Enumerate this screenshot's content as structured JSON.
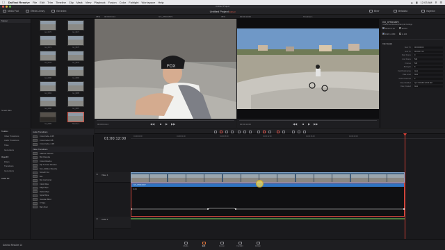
{
  "menubar": {
    "app": "DaVinci Resolve",
    "items": [
      "File",
      "Edit",
      "Trim",
      "Timeline",
      "Clip",
      "Mark",
      "View",
      "Playback",
      "Fusion",
      "Color",
      "Fairlight",
      "Workspace",
      "Help"
    ],
    "clock": "12:03 AM"
  },
  "window_title": "Untitled Project",
  "toolbar": {
    "media_pool": "Media Pool",
    "effects_library": "Effects Library",
    "edit_index": "Edit Index",
    "project": "Untitled Project",
    "project_state": "Edited",
    "mixer": "Mixer",
    "metadata": "Metadata",
    "inspector": "Inspector"
  },
  "subbar": {
    "zoom_left": "35%",
    "tc_left": "00:00:04:14",
    "clip_name": "GX_0793.MOV",
    "zoom_right": "35%",
    "tc_right": "00:00:12:00",
    "timeline_name": "Timeline 1"
  },
  "media_pool": {
    "bin": "Master",
    "smart_bins": "Smart Bins",
    "clips": [
      "GL_0070",
      "GL_0071",
      "GL_0074",
      "GL_0076",
      "GL_0078",
      "GL_0079",
      "GL_0080",
      "GL_0083",
      "GL_0084",
      "GL_0085",
      "GL_0086",
      "GL_0087",
      "GL_0089",
      "Timeline 1"
    ]
  },
  "viewer_left": {
    "tc": "00:00:04:14"
  },
  "viewer_right": {
    "tc": "00:00:12:00"
  },
  "inspector": {
    "clip_title": "GX_0793.MOV",
    "path": "/Users/mac/Desktop/Sample Footage",
    "checkboxes": [
      "00:00:17:19",
      "29.970",
      "1920 x 1080",
      "H.264"
    ],
    "section": "Clip Details",
    "fields": [
      {
        "k": "Start TC",
        "v": "00:00:00:00"
      },
      {
        "k": "End TC",
        "v": "00:00:17:19"
      },
      {
        "k": "Start Frame",
        "v": "0"
      },
      {
        "k": "End Frame",
        "v": "532"
      },
      {
        "k": "Frames",
        "v": "533"
      },
      {
        "k": "Bit Depth",
        "v": "8"
      },
      {
        "k": "Field Dominance",
        "v": "Auto"
      },
      {
        "k": "Data Level",
        "v": "Auto"
      },
      {
        "k": "Audio Channels",
        "v": "2"
      },
      {
        "k": "Date Modified",
        "v": "Apr 6 2016 9:23:03 AM"
      },
      {
        "k": "Date Created",
        "v": "Auto"
      }
    ]
  },
  "effects": {
    "tree": [
      {
        "label": "Toolbox",
        "top": true
      },
      {
        "label": "Video Transitions",
        "top": false
      },
      {
        "label": "Audio Transitions",
        "top": false
      },
      {
        "label": "Titles",
        "top": false
      },
      {
        "label": "Generators",
        "top": false
      },
      {
        "label": "OpenFX",
        "top": true
      },
      {
        "label": "Filters",
        "top": false
      },
      {
        "label": "Transitions",
        "top": false
      },
      {
        "label": "Generators",
        "top": false
      },
      {
        "label": "Audio FX",
        "top": true
      }
    ],
    "audio_header": "Audio Transitions",
    "audio_items": [
      "Cross Fade -3 dB",
      "Cross Fade 0 dB",
      "Cross Fade +3 dB"
    ],
    "video_header": "Video Transitions",
    "video_items": [
      "Additive Dissolve",
      "Blur Dissolve",
      "Cross Dissolve",
      "Dip To Color Dissolve",
      "Non-Additive Dissolve",
      "Smooth Cut",
      "Box",
      "Box Horizontal",
      "Clock Wipe",
      "Edge Wipe",
      "Radial Wipe",
      "Spiral Wipe",
      "Venetian Blind",
      "X Wipe",
      "Barn Door"
    ]
  },
  "timeline": {
    "timecode": "01:00:12:00",
    "ruler": [
      "01:00:00:00",
      "01:00:04:00",
      "01:00:08:00",
      "01:00:12:00",
      "01:00:16:00",
      "01:00:20:00"
    ],
    "video_track": "Video 1",
    "audio_track": "Audio 1",
    "audio_track_id": "A1",
    "video_track_id": "V1",
    "audio_clip": "GX_0793.MOV",
    "audio_sub": "Cross Dissolve",
    "audio_label": "Audio"
  },
  "pages": {
    "brand": "DaVinci Resolve 14",
    "tabs": [
      "Media",
      "Edit",
      "Fusion",
      "Fairlight",
      "Deliver"
    ],
    "active": "Edit"
  },
  "colors": {
    "accent_red": "#d13d33",
    "clip_blue": "#4a6b8c",
    "audio_bar": "#2f74c1",
    "audio_track": "#4b7d3e"
  }
}
